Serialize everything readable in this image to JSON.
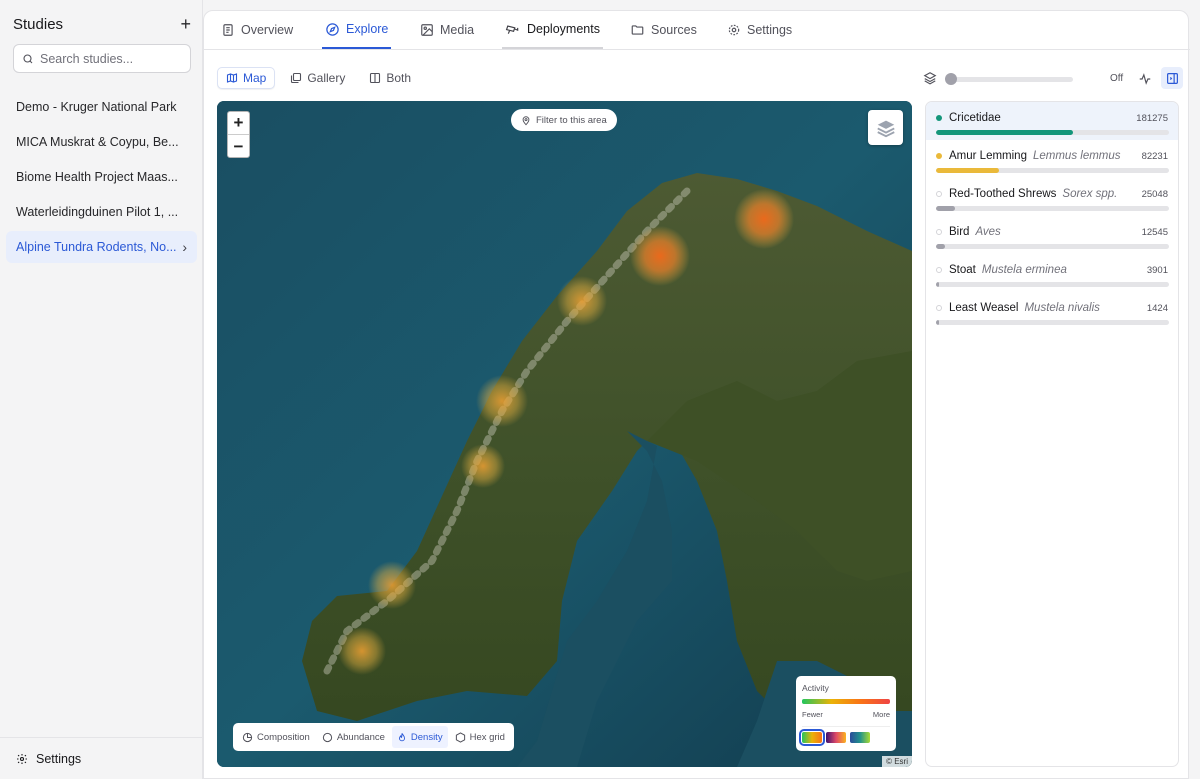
{
  "sidebar": {
    "title": "Studies",
    "search_placeholder": "Search studies...",
    "studies": [
      {
        "label": "Demo - Kruger National Park"
      },
      {
        "label": "MICA Muskrat & Coypu, Be..."
      },
      {
        "label": "Biome Health Project Maas..."
      },
      {
        "label": "Waterleidingduinen Pilot 1, ..."
      },
      {
        "label": "Alpine Tundra Rodents, No...",
        "active": true
      }
    ],
    "footer_label": "Settings"
  },
  "tabs": [
    {
      "label": "Overview",
      "icon": "document-icon"
    },
    {
      "label": "Explore",
      "icon": "compass-icon",
      "active": true
    },
    {
      "label": "Media",
      "icon": "image-icon"
    },
    {
      "label": "Deployments",
      "icon": "camera-icon"
    },
    {
      "label": "Sources",
      "icon": "folder-icon"
    },
    {
      "label": "Settings",
      "icon": "gear-icon"
    }
  ],
  "view_modes": [
    {
      "label": "Map",
      "icon": "map-icon",
      "active": true
    },
    {
      "label": "Gallery",
      "icon": "gallery-icon"
    },
    {
      "label": "Both",
      "icon": "split-icon"
    }
  ],
  "timeline": {
    "state": "Off"
  },
  "map": {
    "filter_label": "Filter to this area",
    "legend": {
      "title": "Activity",
      "low": "Fewer",
      "high": "More"
    },
    "modes": [
      {
        "label": "Composition",
        "icon": "pie-icon"
      },
      {
        "label": "Abundance",
        "icon": "circle-icon"
      },
      {
        "label": "Density",
        "icon": "flame-icon",
        "active": true
      },
      {
        "label": "Hex grid",
        "icon": "hexagon-icon"
      }
    ],
    "attribution": "© Esri"
  },
  "species": [
    {
      "name": "Cricetidae",
      "scientific": "",
      "count": "181275",
      "fraction": 0.59,
      "color": "#14967a",
      "selected": true
    },
    {
      "name": "Amur Lemming",
      "scientific": "Lemmus lemmus",
      "count": "82231",
      "fraction": 0.27,
      "color": "#eab93a"
    },
    {
      "name": "Red-Toothed Shrews",
      "scientific": "Sorex spp.",
      "count": "25048",
      "fraction": 0.08,
      "color": "#a1a1aa"
    },
    {
      "name": "Bird",
      "scientific": "Aves",
      "count": "12545",
      "fraction": 0.04,
      "color": "#a1a1aa"
    },
    {
      "name": "Stoat",
      "scientific": "Mustela erminea",
      "count": "3901",
      "fraction": 0.013,
      "color": "#a1a1aa"
    },
    {
      "name": "Least Weasel",
      "scientific": "Mustela nivalis",
      "count": "1424",
      "fraction": 0.005,
      "color": "#a1a1aa"
    }
  ]
}
